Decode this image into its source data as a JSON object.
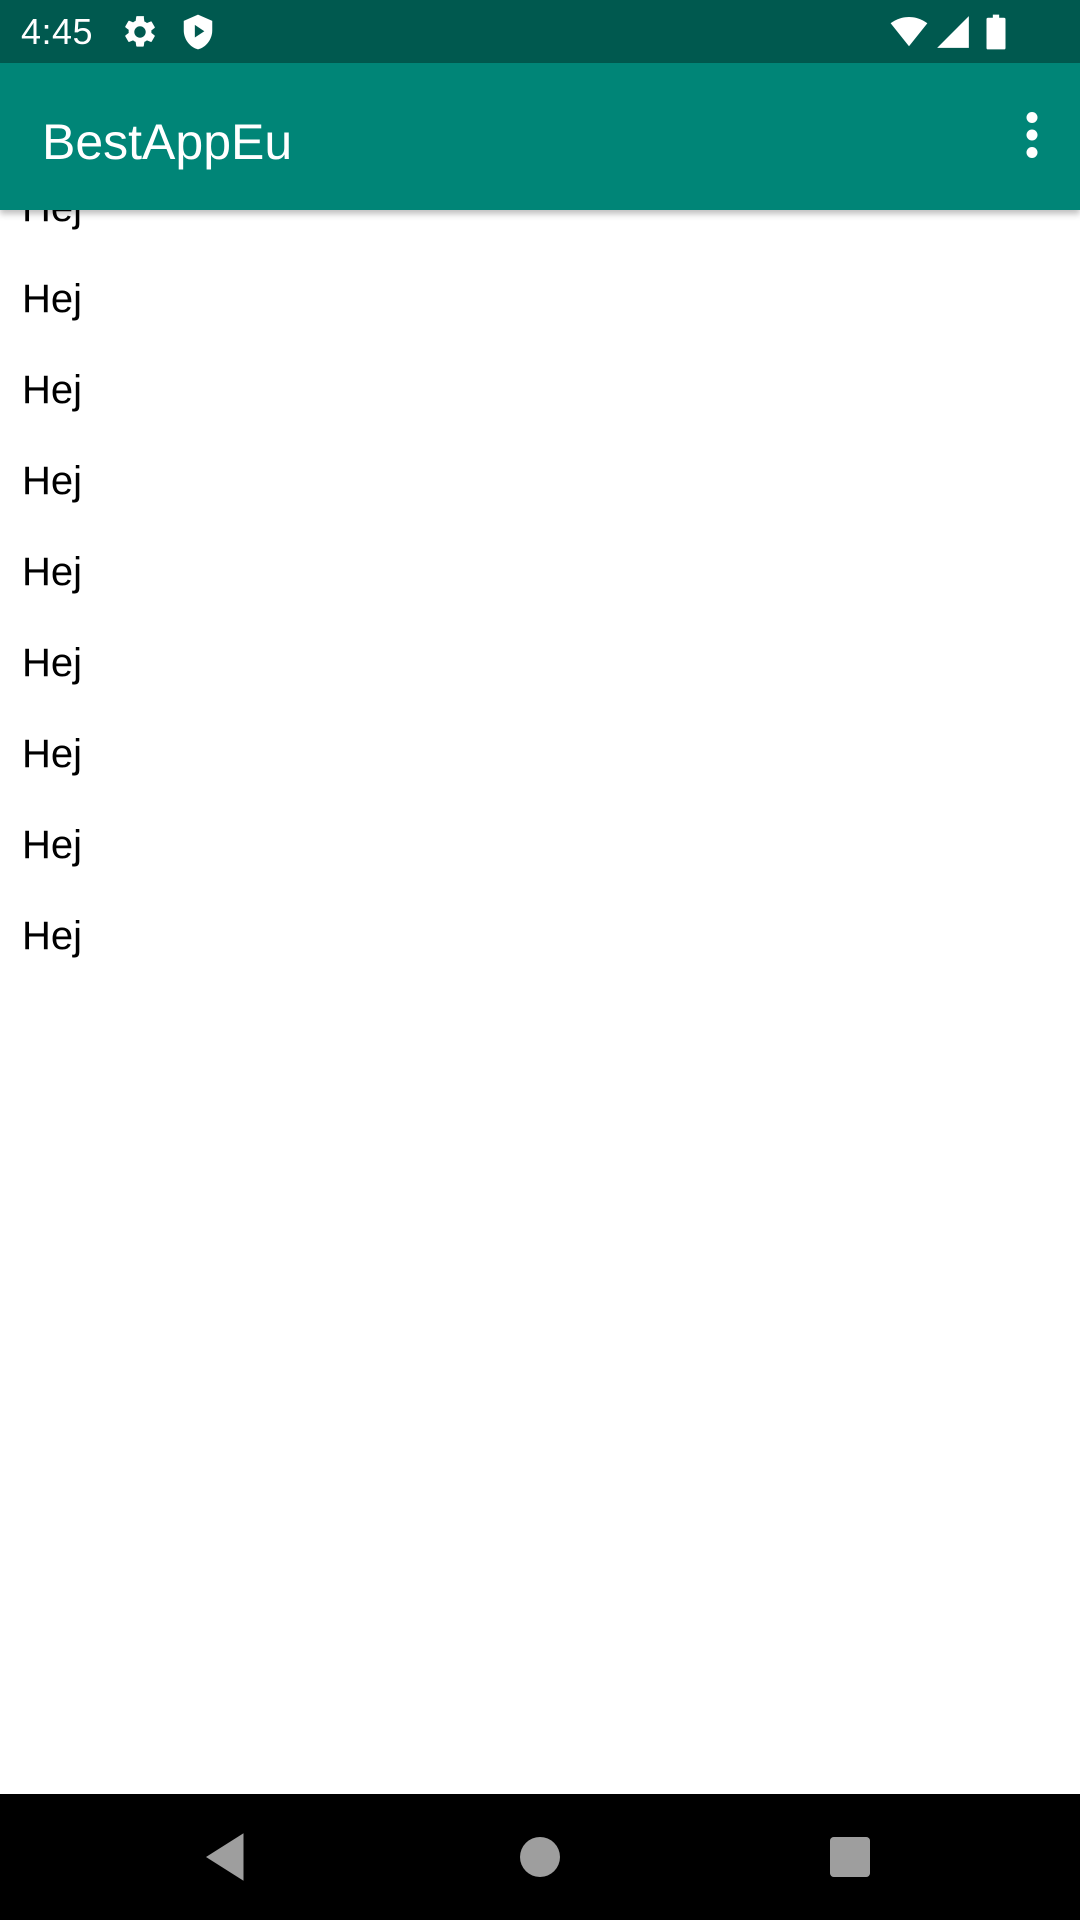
{
  "status_bar": {
    "time": "4:45",
    "icons": [
      "gear-icon",
      "shield-play-icon",
      "wifi-icon",
      "cell-signal-icon",
      "battery-icon"
    ]
  },
  "app_bar": {
    "title": "BestAppEu",
    "overflow_icon": "more-vert-icon"
  },
  "list": {
    "items": [
      {
        "label": "Hej"
      },
      {
        "label": "Hej"
      },
      {
        "label": "Hej"
      },
      {
        "label": "Hej"
      },
      {
        "label": "Hej"
      },
      {
        "label": "Hej"
      },
      {
        "label": "Hej"
      },
      {
        "label": "Hej"
      },
      {
        "label": "Hej"
      }
    ]
  },
  "nav_bar": {
    "icons": [
      "back-icon",
      "home-icon",
      "recents-icon"
    ]
  },
  "colors": {
    "status_bar": "#00594f",
    "app_bar": "#008577",
    "nav_bar": "#000000",
    "nav_icons": "#9e9e9e"
  }
}
